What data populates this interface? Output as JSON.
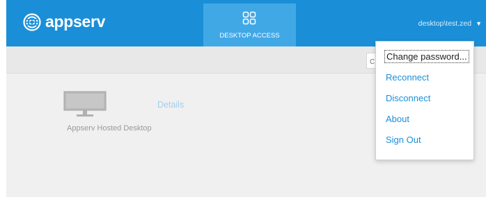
{
  "header": {
    "brand": "appserv",
    "nav_tab_label": "DESKTOP ACCESS",
    "username": "desktop\\test.zed",
    "caret": "▼"
  },
  "toolbar": {
    "search_placeholder": "C"
  },
  "desktops": [
    {
      "name": "Appserv Hosted Desktop",
      "details_label": "Details"
    }
  ],
  "user_dropdown": {
    "items": [
      {
        "label": "Change password..."
      },
      {
        "label": "Reconnect"
      },
      {
        "label": "Disconnect"
      },
      {
        "label": "About"
      },
      {
        "label": "Sign Out"
      }
    ]
  },
  "colors": {
    "header_blue": "#1a8fd8",
    "active_tab_blue": "#41a8e6",
    "link_blue": "#1a8fd8",
    "page_gray": "#f0f0f0"
  },
  "icons": {
    "logo": "appserv-logo-icon",
    "nav_tab": "grid-icon",
    "desktop": "monitor-icon"
  }
}
